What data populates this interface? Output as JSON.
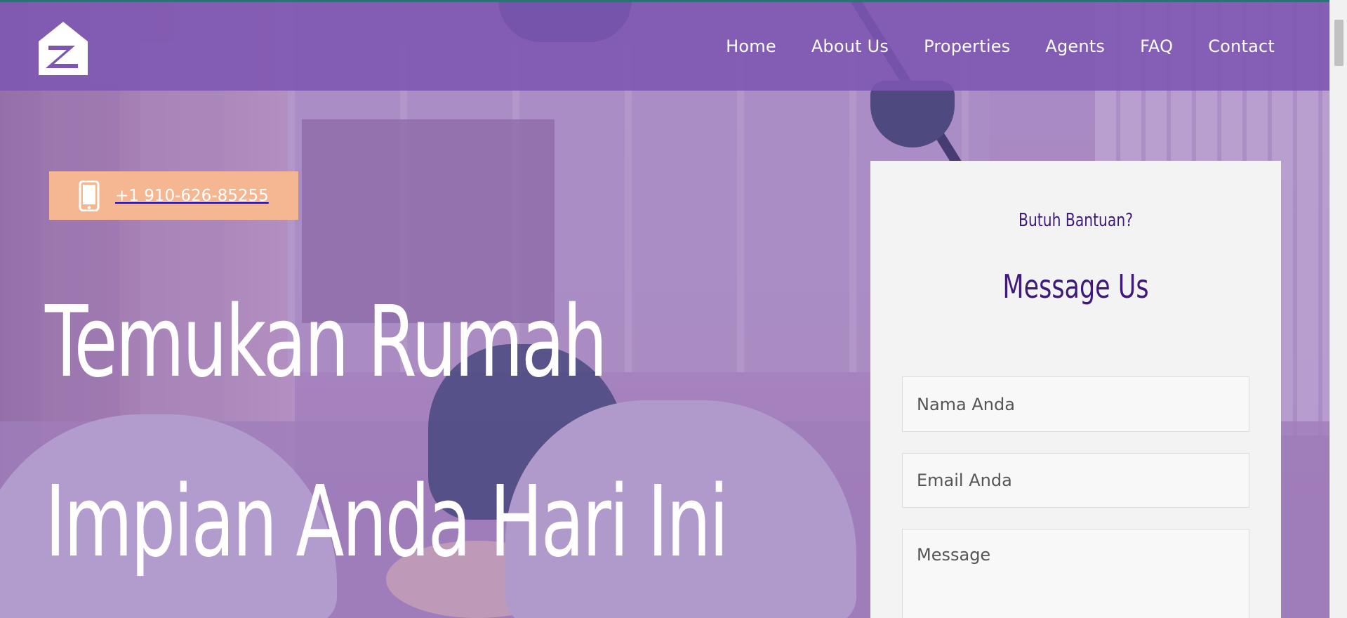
{
  "header": {
    "logo_icon": "house-z-logo-icon",
    "nav": [
      {
        "label": "Home"
      },
      {
        "label": "About Us"
      },
      {
        "label": "Properties"
      },
      {
        "label": "Agents"
      },
      {
        "label": "FAQ"
      },
      {
        "label": "Contact"
      }
    ]
  },
  "hero": {
    "phone": {
      "icon": "mobile-phone-icon",
      "number": "+1 910-626-85255"
    },
    "title_line1": "Temukan Rumah",
    "title_line2": "Impian Anda Hari Ini"
  },
  "form": {
    "help_text": "Butuh Bantuan?",
    "title": "Message Us",
    "name_placeholder": "Nama Anda",
    "email_placeholder": "Email Anda",
    "message_placeholder": "Message"
  },
  "colors": {
    "header_bg": "#7d56b2",
    "phone_badge": "#f5b692",
    "form_title": "#3e1a7a",
    "panel_bg": "#f3f3f3"
  }
}
